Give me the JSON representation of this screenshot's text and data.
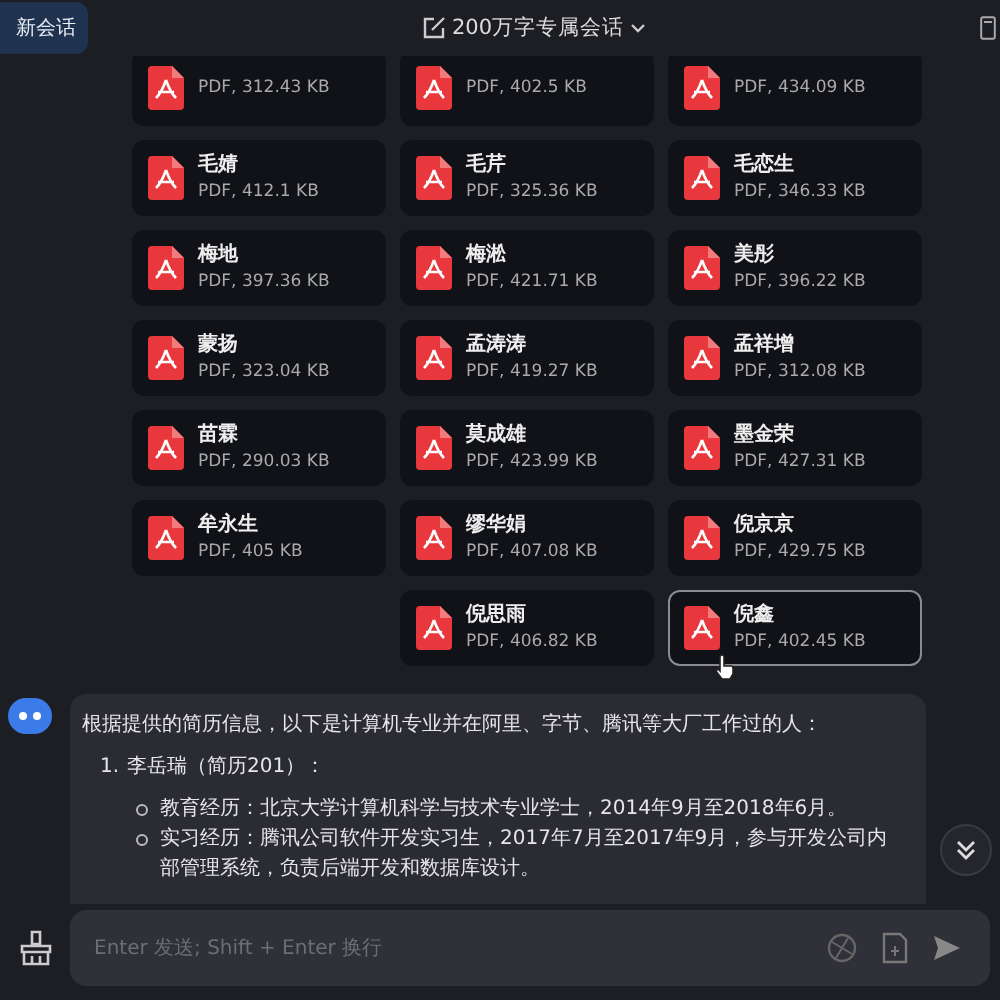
{
  "header": {
    "new_chat": "新会话",
    "title": "200万字专属会话"
  },
  "files": [
    {
      "meta": "PDF, 312.43 KB",
      "selected": false
    },
    {
      "meta": "PDF, 402.5 KB",
      "selected": false
    },
    {
      "meta": "PDF, 434.09 KB",
      "selected": false
    },
    {
      "name": "毛婧",
      "meta": "PDF, 412.1 KB",
      "selected": false
    },
    {
      "name": "毛芹",
      "meta": "PDF, 325.36 KB",
      "selected": false
    },
    {
      "name": "毛恋生",
      "meta": "PDF, 346.33 KB",
      "selected": false
    },
    {
      "name": "梅地",
      "meta": "PDF, 397.36 KB",
      "selected": false
    },
    {
      "name": "梅淞",
      "meta": "PDF, 421.71 KB",
      "selected": false
    },
    {
      "name": "美彤",
      "meta": "PDF, 396.22 KB",
      "selected": false
    },
    {
      "name": "蒙扬",
      "meta": "PDF, 323.04 KB",
      "selected": false
    },
    {
      "name": "孟涛涛",
      "meta": "PDF, 419.27 KB",
      "selected": false
    },
    {
      "name": "孟祥增",
      "meta": "PDF, 312.08 KB",
      "selected": false
    },
    {
      "name": "苗霖",
      "meta": "PDF, 290.03 KB",
      "selected": false
    },
    {
      "name": "莫成雄",
      "meta": "PDF, 423.99 KB",
      "selected": false
    },
    {
      "name": "墨金荣",
      "meta": "PDF, 427.31 KB",
      "selected": false
    },
    {
      "name": "牟永生",
      "meta": "PDF, 405 KB",
      "selected": false
    },
    {
      "name": "缪华娟",
      "meta": "PDF, 407.08 KB",
      "selected": false
    },
    {
      "name": "倪京京",
      "meta": "PDF, 429.75 KB",
      "selected": false
    },
    {
      "name": "倪思雨",
      "meta": "PDF, 406.82 KB",
      "selected": false
    },
    {
      "name": "倪鑫",
      "meta": "PDF, 402.45 KB",
      "selected": true
    }
  ],
  "message": {
    "intro": "根据提供的简历信息，以下是计算机专业并在阿里、字节、腾讯等大厂工作过的人：",
    "items": [
      {
        "number": "1.",
        "title": "李岳瑞（简历201）：",
        "details": [
          "教育经历：北京大学计算机科学与技术专业学士，2014年9月至2018年6月。",
          "实习经历：腾讯公司软件开发实习生，2017年7月至2017年9月，参与开发公司内部管理系统，负责后端开发和数据库设计。"
        ]
      }
    ]
  },
  "input": {
    "placeholder": "Enter 发送; Shift + Enter 换行"
  }
}
